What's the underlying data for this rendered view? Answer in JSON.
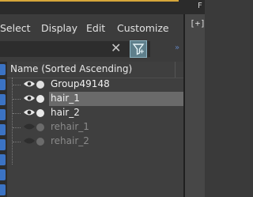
{
  "window": {
    "corner_text": "F"
  },
  "menu": {
    "items": [
      "Select",
      "Display",
      "Edit",
      "Customize"
    ]
  },
  "viewport": {
    "label": "[+]"
  },
  "search": {
    "value": ""
  },
  "outliner": {
    "column_header": "Name (Sorted Ascending)",
    "rows": [
      {
        "label": "Group49148",
        "state": "active",
        "visible": true
      },
      {
        "label": "hair_1",
        "state": "active",
        "visible": true,
        "selected": true
      },
      {
        "label": "hair_2",
        "state": "active",
        "visible": true
      },
      {
        "label": "rehair_1",
        "state": "inactive",
        "visible": false
      },
      {
        "label": "rehair_2",
        "state": "inactive",
        "visible": false
      }
    ]
  },
  "colors": {
    "accent": "#d6a63a",
    "filter_button": "#5e7f8b",
    "toolbar_icons": "#3b73c4",
    "selection": "#6a6a6a"
  },
  "icons": [
    "close-icon",
    "filter-icon",
    "double-chevron-icon",
    "eye-icon"
  ]
}
